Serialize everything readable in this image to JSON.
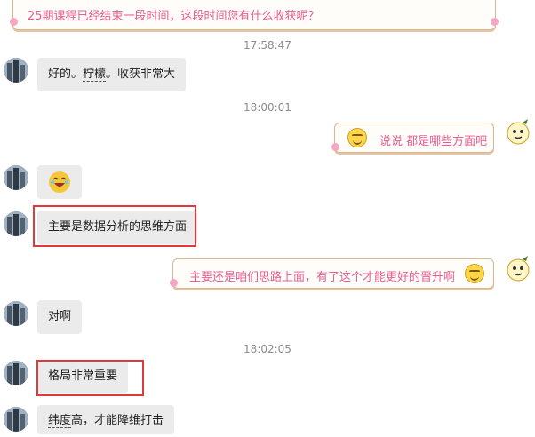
{
  "messages": {
    "top_partial": "25期课程已经结束一段时间，这段时间您有什么收获呢？",
    "ts1": "17:58:47",
    "m1_pre": "好的。",
    "m1_ul": "柠檬",
    "m1_post": "。收获非常大",
    "ts2": "18:00:01",
    "r1": "说说 都是哪些方面吧",
    "m3_pre": "主要是",
    "m3_ul": "数据分析",
    "m3_post": "的思维方面",
    "r2": "主要还是咱们思路上面，有了这个才能更好的晋升啊",
    "m4": "对啊",
    "ts3": "18:02:05",
    "m5": "格局非常重要",
    "m6_pre": "纬度",
    "m6_post": "高，才能降维打击"
  },
  "icons": {
    "avatar": "user-avatar",
    "smile": "smiley-emoticon",
    "mascot": "mascot-avatar",
    "emoji": "laughing-emoji"
  },
  "colors": {
    "highlight": "#e0393b",
    "pink_text": "#ea5c92",
    "bubble_grey": "#ebebeb"
  }
}
